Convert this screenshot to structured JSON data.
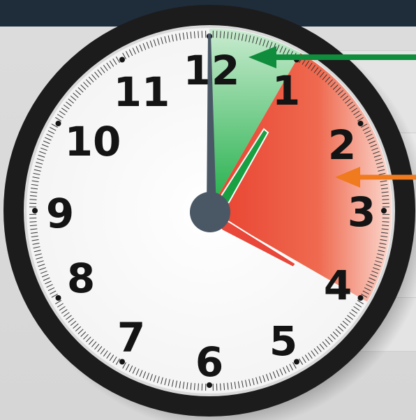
{
  "clock": {
    "hour_numbers": [
      "12",
      "1",
      "2",
      "3",
      "4",
      "5",
      "6",
      "7",
      "8",
      "9",
      "10",
      "11"
    ],
    "time_shown": "12:00 → 4:00",
    "elapsed_highlight": {
      "from_hour": 12,
      "to_hour": 1,
      "color": "#2eb54f"
    },
    "remaining_highlight": {
      "from_hour": 1,
      "to_hour": 4,
      "color": "#ee4b37"
    },
    "colors": {
      "frame": "#1c1c1c",
      "face": "#ffffff",
      "minute_hand": "#4a5866",
      "hour_hand_green": "#19a043",
      "hour_hand_red": "#e8473a",
      "hub": "#4a5866"
    }
  },
  "arrows": [
    {
      "name": "green-arrow",
      "color": "#0f8c3c"
    },
    {
      "name": "orange-arrow",
      "color": "#f07a1e"
    }
  ]
}
